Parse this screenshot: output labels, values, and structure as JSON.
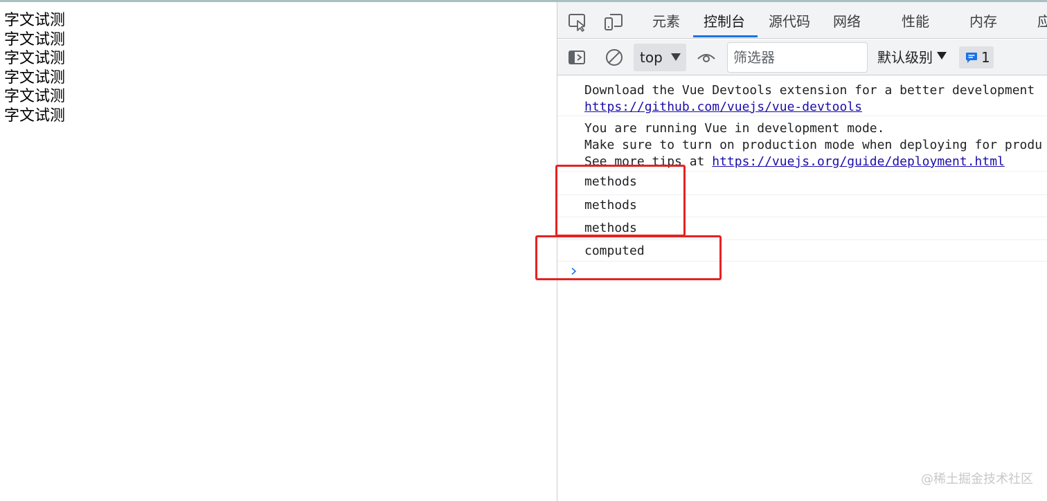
{
  "page": {
    "lines": [
      "字文试测",
      "字文试测",
      "字文试测",
      "字文试测",
      "字文试测",
      "字文试测"
    ]
  },
  "devtools": {
    "tabs": [
      {
        "label": "元素",
        "active": false
      },
      {
        "label": "控制台",
        "active": true
      },
      {
        "label": "源代码",
        "active": false
      },
      {
        "label": "网络",
        "active": false
      },
      {
        "label": "性能",
        "active": false
      },
      {
        "label": "内存",
        "active": false
      },
      {
        "label": "应",
        "active": false
      }
    ],
    "toolbar_icons": [
      "inspect-element-icon",
      "device-toolbar-icon"
    ],
    "console_toolbar": {
      "context": "top",
      "filter_placeholder": "筛选器",
      "log_level": "默认级别",
      "issues_count": "1"
    },
    "messages": {
      "m1_line1": "Download the Vue Devtools extension for a better development",
      "m1_link": "https://github.com/vuejs/vue-devtools",
      "m2_line1": "You are running Vue in development mode.",
      "m2_line2": "Make sure to turn on production mode when deploying for produ",
      "m2_line3_prefix": "See more tips at ",
      "m2_link": "https://vuejs.org/guide/deployment.html",
      "m3": "methods",
      "m4": "methods",
      "m5": "methods",
      "m6": "computed"
    },
    "accent_color": "#1a73e8",
    "highlight_color": "#e62121"
  },
  "watermark": "@稀土掘金技术社区"
}
